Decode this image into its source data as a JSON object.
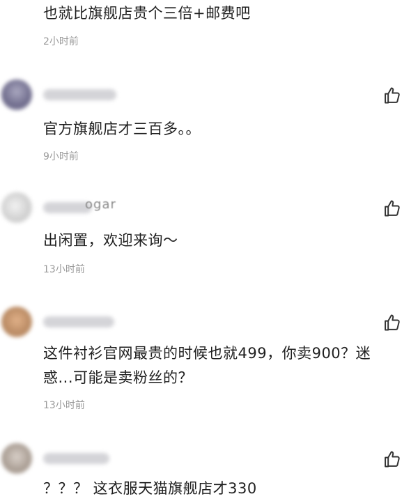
{
  "comments": [
    {
      "text": "也就比旗舰店贵个三倍+邮费吧",
      "time": "2小时前"
    },
    {
      "text": "官方旗舰店才三百多。。",
      "time": "9小时前"
    },
    {
      "username_partial": "ogar",
      "text": "出闲置，欢迎来询～",
      "time": "13小时前"
    },
    {
      "text": "这件衬衫官网最贵的时候也就499，你卖900？迷惑...可能是卖粉丝的？",
      "time": "13小时前"
    },
    {
      "text": "？？？ 这衣服天猫旗舰店才330"
    }
  ],
  "icons": {
    "like": "thumbs-up-outline-icon"
  },
  "colors": {
    "text": "#1f1f1f",
    "time": "#9a9a9a",
    "background": "#ffffff",
    "icon": "#333333"
  }
}
